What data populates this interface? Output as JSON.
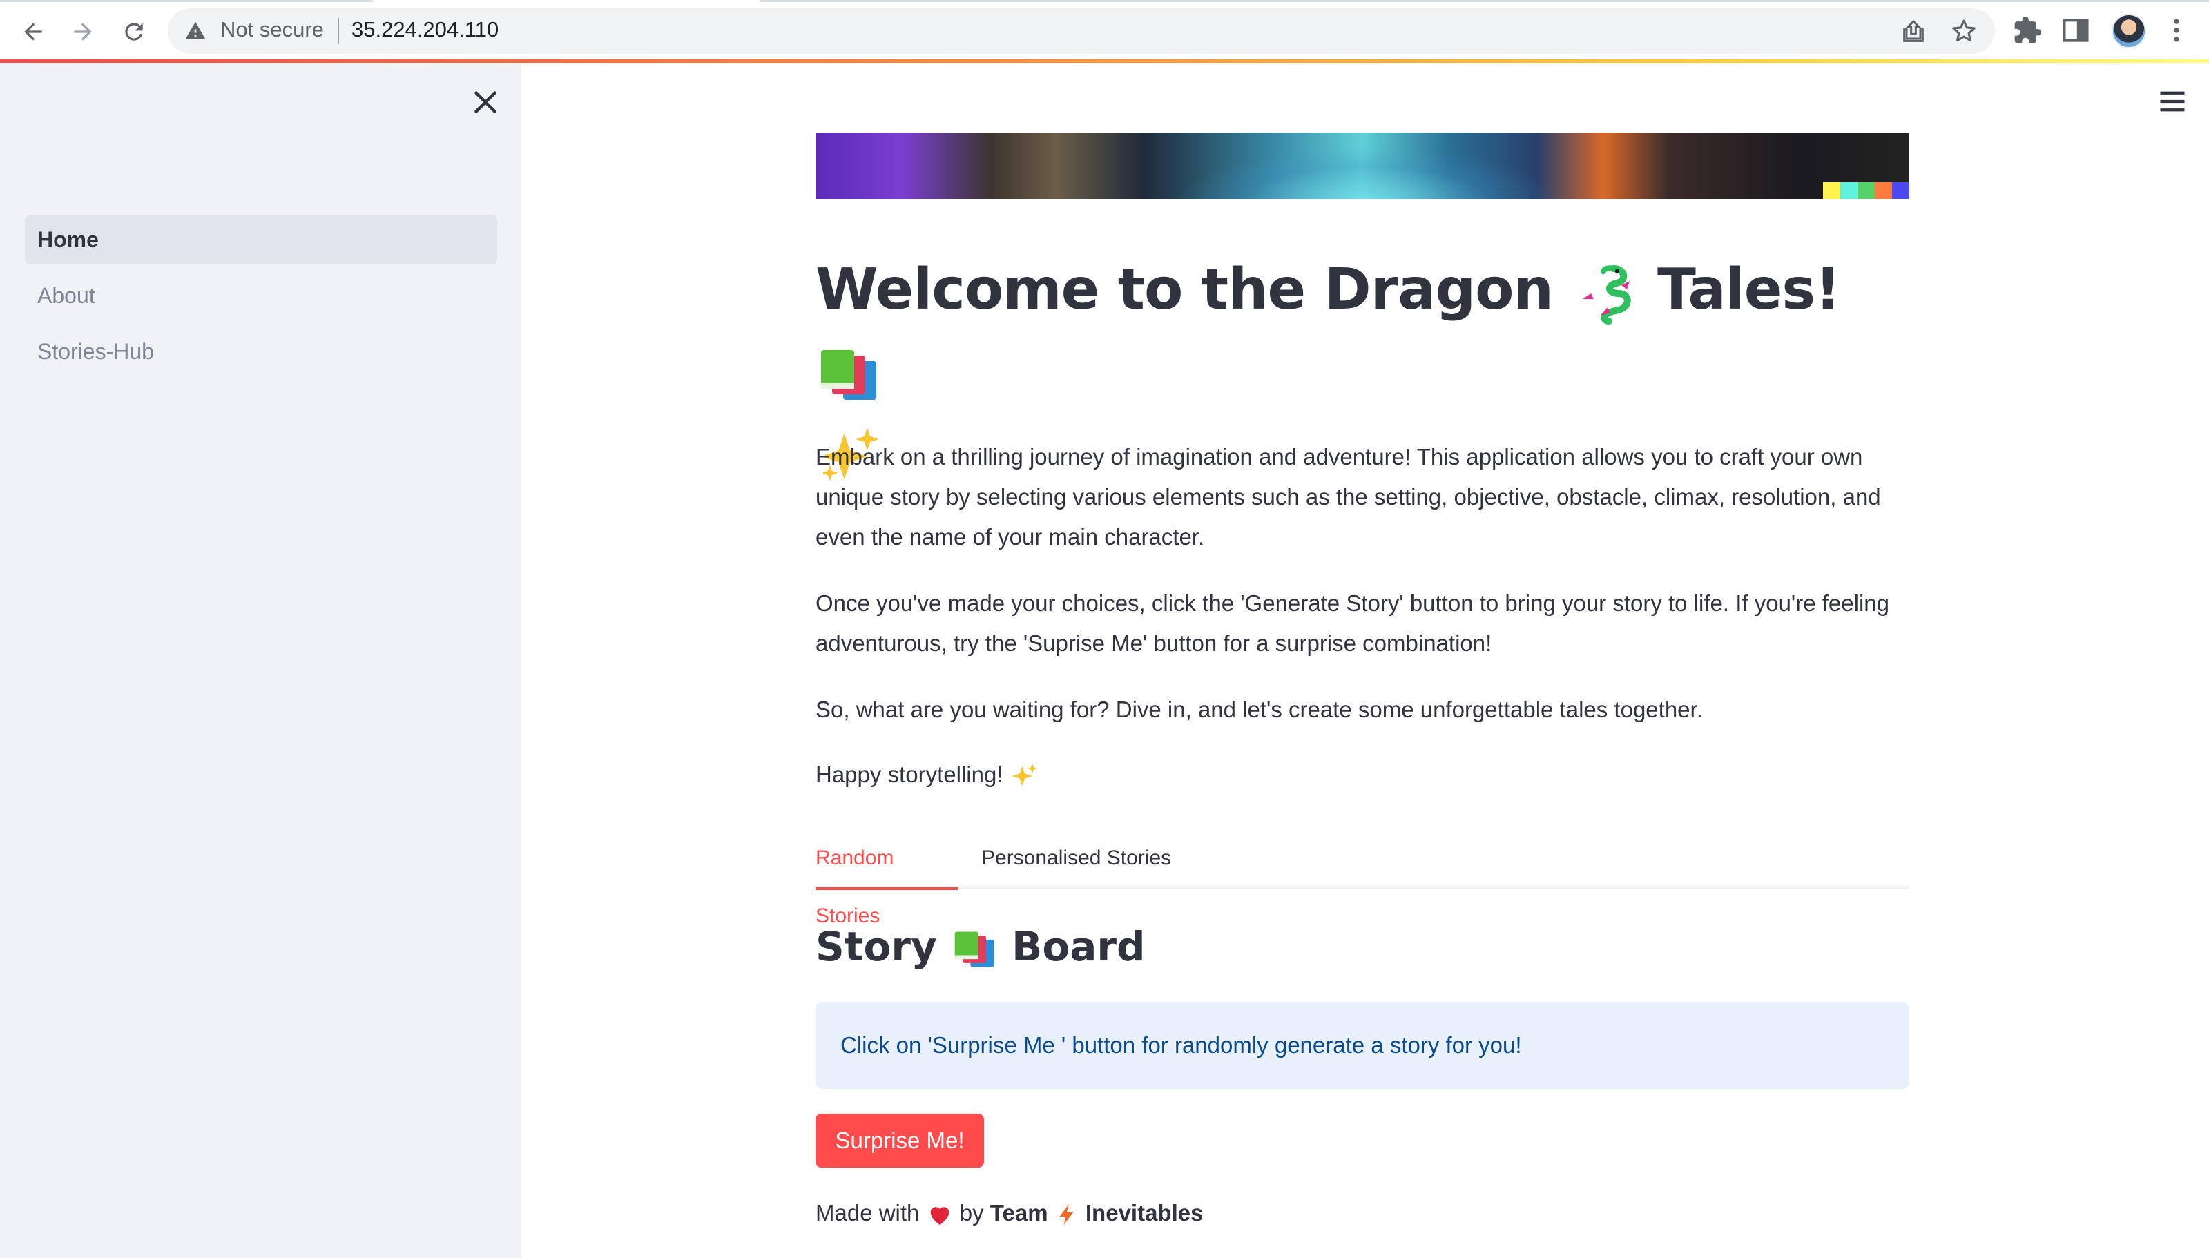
{
  "browser": {
    "security_label": "Not secure",
    "url": "35.224.204.110",
    "icons": [
      "back-arrow-icon",
      "forward-arrow-icon",
      "reload-icon",
      "warning-triangle-icon",
      "share-icon",
      "star-icon",
      "extensions-icon",
      "side-panel-icon",
      "profile-avatar",
      "kebab-menu-icon"
    ]
  },
  "sidebar": {
    "items": [
      {
        "label": "Home",
        "active": true
      },
      {
        "label": "About",
        "active": false
      },
      {
        "label": "Stories-Hub",
        "active": false
      }
    ]
  },
  "main": {
    "title_text": "Welcome to the Dragon",
    "title_text2": "Tales!",
    "paragraphs": [
      "Embark on a thrilling journey of imagination and adventure! This application allows you to craft your own unique story by selecting various elements such as the setting, objective, obstacle, climax, resolution, and even the name of your main character.",
      "Once you've made your choices, click the 'Generate Story' button to bring your story to life. If you're feeling adventurous, try the 'Suprise Me' button for a surprise combination!",
      "So, what are you waiting for? Dive in, and let's create some unforgettable tales together.",
      "Happy storytelling!"
    ],
    "tabs": [
      {
        "label": "Random Stories",
        "active": true
      },
      {
        "label": "Personalised Stories",
        "active": false
      }
    ],
    "section_title_1": "Story",
    "section_title_2": "Board",
    "info_text": "Click on 'Surprise Me ' button for randomly generate a story for you!",
    "button_label": "Surprise Me!",
    "footer": {
      "made_with": "Made with",
      "by": "by",
      "team": "Team",
      "name": "Inevitables"
    }
  },
  "colors": {
    "accent": "#ff4b4b",
    "sidebar_bg": "#f0f2f6",
    "info_bg": "#e8f1fb",
    "info_text": "#0b4a8a",
    "text": "#31333f"
  }
}
